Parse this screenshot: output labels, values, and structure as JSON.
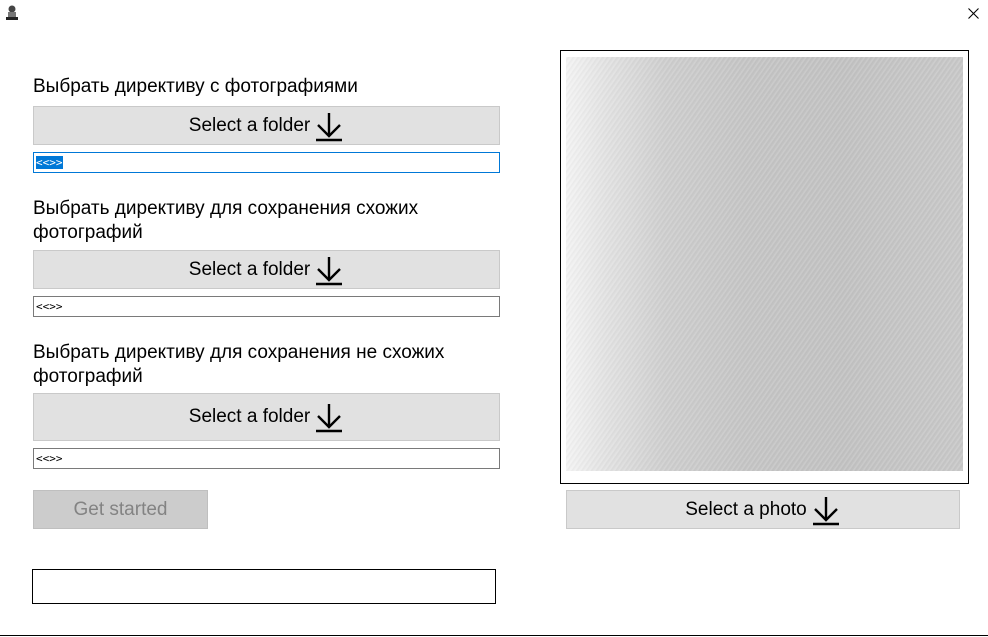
{
  "window": {
    "close_glyph": "×"
  },
  "sections": [
    {
      "label": "Выбрать директиву с фотографиями",
      "button_label": "Select a folder",
      "path_value": "<<>>"
    },
    {
      "label": "Выбрать директиву для сохранения схожих фотографий",
      "button_label": "Select a folder",
      "path_value": "<<>>"
    },
    {
      "label": "Выбрать директиву для сохранения не схожих фотографий",
      "button_label": "Select a folder",
      "path_value": "<<>>"
    }
  ],
  "start_button": {
    "label": "Get started",
    "disabled": true
  },
  "status_text": "",
  "photo_button": {
    "label": "Select a photo"
  },
  "icons": {
    "app": "app-icon",
    "close": "close-icon",
    "arrow": "arrow-down-icon"
  }
}
